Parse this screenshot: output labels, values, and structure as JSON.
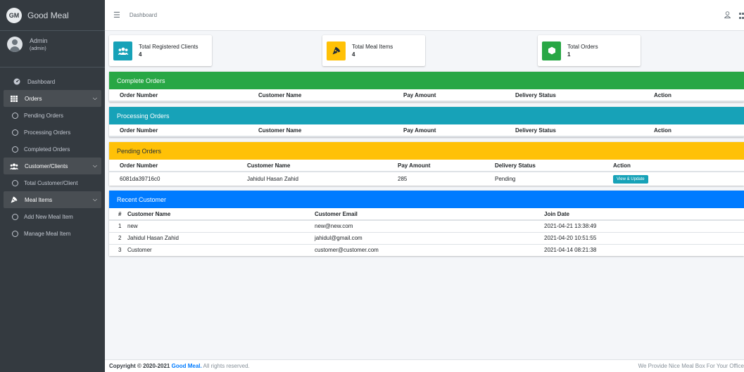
{
  "brand": {
    "logo_text": "GM",
    "title": "Good Meal"
  },
  "user": {
    "name": "Admin",
    "role": "(admin)"
  },
  "sidebar": {
    "items": [
      {
        "label": "Dashboard",
        "icon": "dashboard-icon"
      },
      {
        "label": "Orders",
        "icon": "grid-icon",
        "section": true
      },
      {
        "label": "Pending Orders",
        "icon": "circle-icon"
      },
      {
        "label": "Processing Orders",
        "icon": "circle-icon"
      },
      {
        "label": "Completed Orders",
        "icon": "circle-icon"
      },
      {
        "label": "Customer/Clients",
        "icon": "users-icon",
        "section": true
      },
      {
        "label": "Total Customer/Client",
        "icon": "circle-icon"
      },
      {
        "label": "Meal Items",
        "icon": "pizza-icon",
        "section": true
      },
      {
        "label": "Add New Meal Item",
        "icon": "circle-icon"
      },
      {
        "label": "Manage Meal Item",
        "icon": "circle-icon"
      }
    ]
  },
  "topbar": {
    "breadcrumb": "Dashboard"
  },
  "info_boxes": [
    {
      "label": "Total Registered Clients",
      "value": "4",
      "color": "#17a2b8",
      "icon": "users-icon"
    },
    {
      "label": "Total Meal Items",
      "value": "4",
      "color": "#ffc107",
      "icon": "pizza-icon"
    },
    {
      "label": "Total Orders",
      "value": "1",
      "color": "#28a745",
      "icon": "cube-icon"
    }
  ],
  "complete_orders": {
    "title": "Complete Orders",
    "color": "#28a745",
    "columns": [
      "Order Number",
      "Customer Name",
      "Pay Amount",
      "Delivery Status",
      "Action"
    ]
  },
  "processing_orders": {
    "title": "Processing Orders",
    "color": "#17a2b8",
    "columns": [
      "Order Number",
      "Customer Name",
      "Pay Amount",
      "Delivery Status",
      "Action"
    ]
  },
  "pending_orders": {
    "title": "Pending Orders",
    "color": "#ffc107",
    "columns": [
      "Order Number",
      "Customer Name",
      "Pay Amount",
      "Delivery Status",
      "Action"
    ],
    "rows": [
      {
        "order_number": "6081da39716c0",
        "customer_name": "Jahidul Hasan Zahid",
        "pay_amount": "285",
        "delivery_status": "Pending",
        "action": "View & Update"
      }
    ]
  },
  "recent_customer": {
    "title": "Recent Customer",
    "color": "#007bff",
    "columns": [
      "#",
      "Customer Name",
      "Customer Email",
      "Join Date"
    ],
    "rows": [
      {
        "num": "1",
        "name": "new",
        "email": "new@new.com",
        "join_date": "2021-04-21 13:38:49"
      },
      {
        "num": "2",
        "name": "Jahidul Hasan Zahid",
        "email": "jahidul@gmail.com",
        "join_date": "2021-04-20 10:51:55"
      },
      {
        "num": "3",
        "name": "Customer",
        "email": "customer@customer.com",
        "join_date": "2021-04-14 08:21:38"
      }
    ]
  },
  "footer": {
    "copyright": "Copyright © 2020-2021",
    "brand_link": "Good Meal.",
    "rights": "All rights reserved.",
    "tagline": "We Provide Nice Meal Box For Your Office"
  }
}
